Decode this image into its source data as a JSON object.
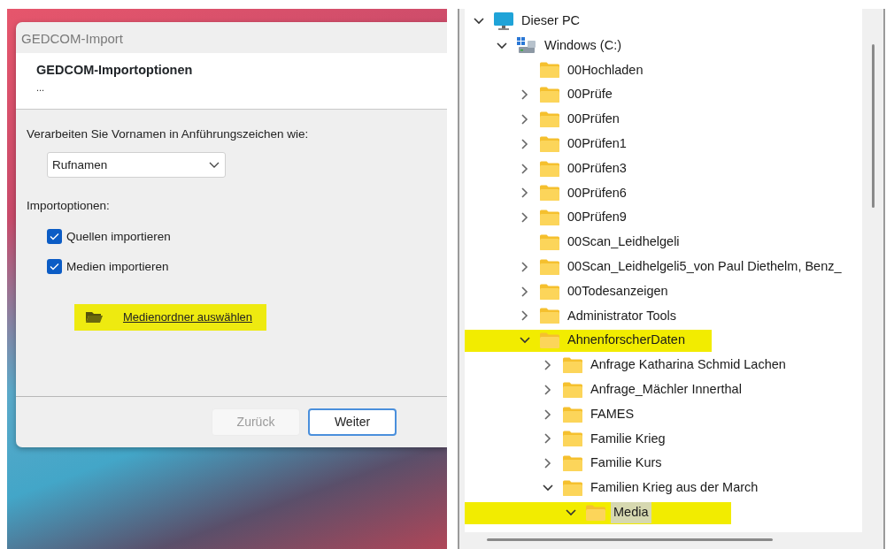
{
  "dialog": {
    "title": "GEDCOM-Import",
    "heading": "GEDCOM-Importoptionen",
    "subheading": "...",
    "quote_label": "Verarbeiten Sie Vornamen in Anführungszeichen wie:",
    "quote_select": {
      "value": "Rufnamen"
    },
    "options_label": "Importoptionen:",
    "checkboxes": [
      {
        "label": "Quellen importieren",
        "checked": true
      },
      {
        "label": "Medien importieren",
        "checked": true
      }
    ],
    "media_link": {
      "label": "Medienordner auswählen",
      "highlighted": true
    },
    "buttons": [
      {
        "label": "Zurück",
        "disabled": true,
        "default": false
      },
      {
        "label": "Weiter",
        "disabled": false,
        "default": true
      }
    ]
  },
  "tree": [
    {
      "label": "Dieser PC",
      "kind": "pc",
      "has_children": true,
      "expanded": true,
      "selected": false,
      "highlighted": false,
      "children": [
        {
          "label": "Windows  (C:)",
          "kind": "drive",
          "has_children": true,
          "expanded": true,
          "selected": false,
          "highlighted": false,
          "children": [
            {
              "label": "00Hochladen",
              "kind": "folder",
              "has_children": false,
              "selected": false,
              "highlighted": false
            },
            {
              "label": "00Prüfe",
              "kind": "folder",
              "has_children": true,
              "expanded": false,
              "selected": false,
              "highlighted": false
            },
            {
              "label": "00Prüfen",
              "kind": "folder",
              "has_children": true,
              "expanded": false,
              "selected": false,
              "highlighted": false
            },
            {
              "label": "00Prüfen1",
              "kind": "folder",
              "has_children": true,
              "expanded": false,
              "selected": false,
              "highlighted": false
            },
            {
              "label": "00Prüfen3",
              "kind": "folder",
              "has_children": true,
              "expanded": false,
              "selected": false,
              "highlighted": false
            },
            {
              "label": "00Prüfen6",
              "kind": "folder",
              "has_children": true,
              "expanded": false,
              "selected": false,
              "highlighted": false
            },
            {
              "label": "00Prüfen9",
              "kind": "folder",
              "has_children": true,
              "expanded": false,
              "selected": false,
              "highlighted": false
            },
            {
              "label": "00Scan_Leidhelgeli",
              "kind": "folder",
              "has_children": false,
              "selected": false,
              "highlighted": false
            },
            {
              "label": "00Scan_Leidhelgeli5_von Paul Diethelm, Benz_",
              "kind": "folder",
              "has_children": true,
              "expanded": false,
              "selected": false,
              "highlighted": false
            },
            {
              "label": "00Todesanzeigen",
              "kind": "folder",
              "has_children": true,
              "expanded": false,
              "selected": false,
              "highlighted": false
            },
            {
              "label": "Administrator Tools",
              "kind": "folder",
              "has_children": true,
              "expanded": false,
              "selected": false,
              "highlighted": false
            },
            {
              "label": "AhnenforscherDaten",
              "kind": "folder",
              "has_children": true,
              "expanded": true,
              "selected": false,
              "highlighted": true,
              "children": [
                {
                  "label": "Anfrage Katharina Schmid Lachen",
                  "kind": "folder",
                  "has_children": true,
                  "expanded": false,
                  "selected": false,
                  "highlighted": false
                },
                {
                  "label": "Anfrage_Mächler Innerthal",
                  "kind": "folder",
                  "has_children": true,
                  "expanded": false,
                  "selected": false,
                  "highlighted": false
                },
                {
                  "label": "FAMES",
                  "kind": "folder",
                  "has_children": true,
                  "expanded": false,
                  "selected": false,
                  "highlighted": false
                },
                {
                  "label": "Familie Krieg",
                  "kind": "folder",
                  "has_children": true,
                  "expanded": false,
                  "selected": false,
                  "highlighted": false
                },
                {
                  "label": "Familie Kurs",
                  "kind": "folder",
                  "has_children": true,
                  "expanded": false,
                  "selected": false,
                  "highlighted": false
                },
                {
                  "label": "Familien Krieg aus der March",
                  "kind": "folder",
                  "has_children": true,
                  "expanded": true,
                  "selected": false,
                  "highlighted": false,
                  "children": [
                    {
                      "label": "Media",
                      "kind": "folder",
                      "has_children": true,
                      "expanded": true,
                      "selected": true,
                      "highlighted": true
                    }
                  ]
                }
              ]
            }
          ]
        }
      ]
    }
  ]
}
